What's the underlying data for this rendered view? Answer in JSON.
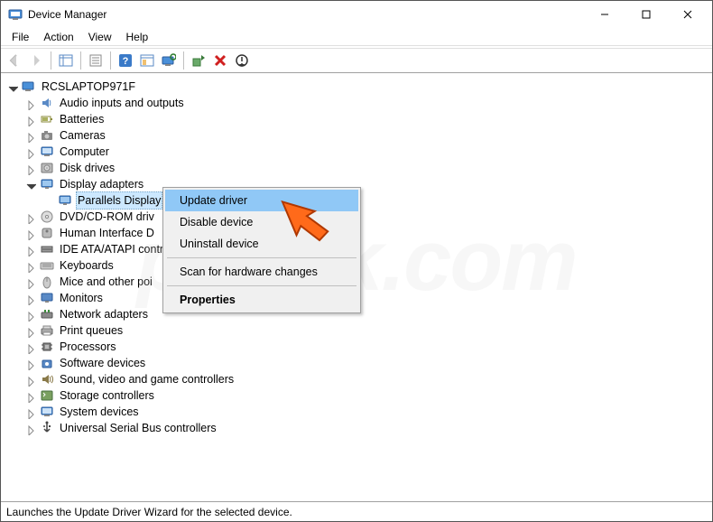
{
  "titlebar": {
    "title": "Device Manager"
  },
  "menubar": {
    "file": "File",
    "action": "Action",
    "view": "View",
    "help": "Help"
  },
  "root_name": "RCSLAPTOP971F",
  "tree": [
    {
      "label": "Audio inputs and outputs",
      "icon": "audio"
    },
    {
      "label": "Batteries",
      "icon": "battery"
    },
    {
      "label": "Cameras",
      "icon": "camera"
    },
    {
      "label": "Computer",
      "icon": "computer"
    },
    {
      "label": "Disk drives",
      "icon": "disk"
    },
    {
      "label": "Display adapters",
      "icon": "display",
      "expanded": true,
      "children": [
        {
          "label": "Parallels Display",
          "icon": "display",
          "selected": true
        }
      ]
    },
    {
      "label": "DVD/CD-ROM driv",
      "icon": "dvd"
    },
    {
      "label": "Human Interface D",
      "icon": "hid"
    },
    {
      "label": "IDE ATA/ATAPI contr",
      "icon": "ide"
    },
    {
      "label": "Keyboards",
      "icon": "keyboard"
    },
    {
      "label": "Mice and other poi",
      "icon": "mouse"
    },
    {
      "label": "Monitors",
      "icon": "monitor"
    },
    {
      "label": "Network adapters",
      "icon": "network"
    },
    {
      "label": "Print queues",
      "icon": "printer"
    },
    {
      "label": "Processors",
      "icon": "cpu"
    },
    {
      "label": "Software devices",
      "icon": "software"
    },
    {
      "label": "Sound, video and game controllers",
      "icon": "sound"
    },
    {
      "label": "Storage controllers",
      "icon": "storage"
    },
    {
      "label": "System devices",
      "icon": "system"
    },
    {
      "label": "Universal Serial Bus controllers",
      "icon": "usb"
    }
  ],
  "context_menu": {
    "update": "Update driver",
    "disable": "Disable device",
    "uninstall": "Uninstall device",
    "scan": "Scan for hardware changes",
    "properties": "Properties"
  },
  "statusbar": "Launches the Update Driver Wizard for the selected device.",
  "watermark": "pcrisk.com"
}
